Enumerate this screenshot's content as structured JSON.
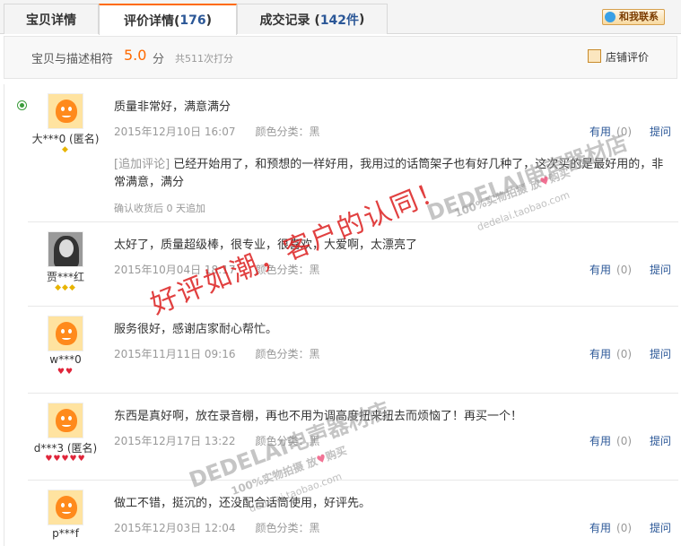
{
  "tabs": [
    {
      "label": "宝贝详情",
      "count": "",
      "suffix": ""
    },
    {
      "label": "评价详情(",
      "count": "176",
      "suffix": ")"
    },
    {
      "label": "成交记录 (",
      "count": "142件",
      "suffix": ")"
    }
  ],
  "contact_label": "和我联系",
  "summary": {
    "label": "宝贝与描述相符",
    "score": "5.0",
    "unit": "分",
    "votes": "共511次打分",
    "shop_rating": "店铺评价"
  },
  "reviews": [
    {
      "user": "大***0 (匿名)",
      "content": "质量非常好，满意满分",
      "date": "2015年12月10日 16:07",
      "color": "颜色分类：黑",
      "helpful": "有用",
      "helpful_count": "(0)",
      "ask": "提问",
      "badge": "◆",
      "append_tag": "[追加评论]",
      "append_text": "已经开始用了，和预想的一样好用，我用过的话筒架子也有好几种了，这次买的是最好用的，非常满意，满分",
      "confirm": "确认收货后 0 天追加"
    },
    {
      "user": "贾***红",
      "content": "太好了，质量超级棒，很专业，很喜欢，大爱啊，太漂亮了",
      "date": "2015年10月04日 18:17",
      "color": "颜色分类：黑",
      "helpful": "有用",
      "helpful_count": "(0)",
      "ask": "提问",
      "badge": "◆◆◆"
    },
    {
      "user": "w***0",
      "content": "服务很好，感谢店家耐心帮忙。",
      "date": "2015年11月11日 09:16",
      "color": "颜色分类：黑",
      "helpful": "有用",
      "helpful_count": "(0)",
      "ask": "提问",
      "badge": "♥♥"
    },
    {
      "user": "d***3 (匿名)",
      "content": "东西是真好啊，放在录音棚，再也不用为调高度扭来扭去而烦恼了！再买一个！",
      "date": "2015年12月17日 13:22",
      "color": "颜色分类：黑",
      "helpful": "有用",
      "helpful_count": "(0)",
      "ask": "提问",
      "badge": "♥♥♥♥♥"
    },
    {
      "user": "p***f",
      "content": "做工不错，挺沉的，还没配合话筒使用，好评先。",
      "date": "2015年12月03日 12:04",
      "color": "颜色分类：黑",
      "helpful": "有用",
      "helpful_count": "(0)",
      "ask": "提问",
      "badge": ""
    }
  ],
  "watermark": {
    "slogan": "好评如潮，客户的认同！",
    "logo": "DEDELAI电声器材店",
    "sub_a": "100%实物拍摄 放",
    "sub_b": "购买",
    "heart": "♥",
    "url": "dedelai.taobao.com"
  },
  "colors": {
    "accent": "#ff6a00",
    "link": "#2b5797",
    "muted": "#999999",
    "watermark_red": "#dc1e1e"
  }
}
